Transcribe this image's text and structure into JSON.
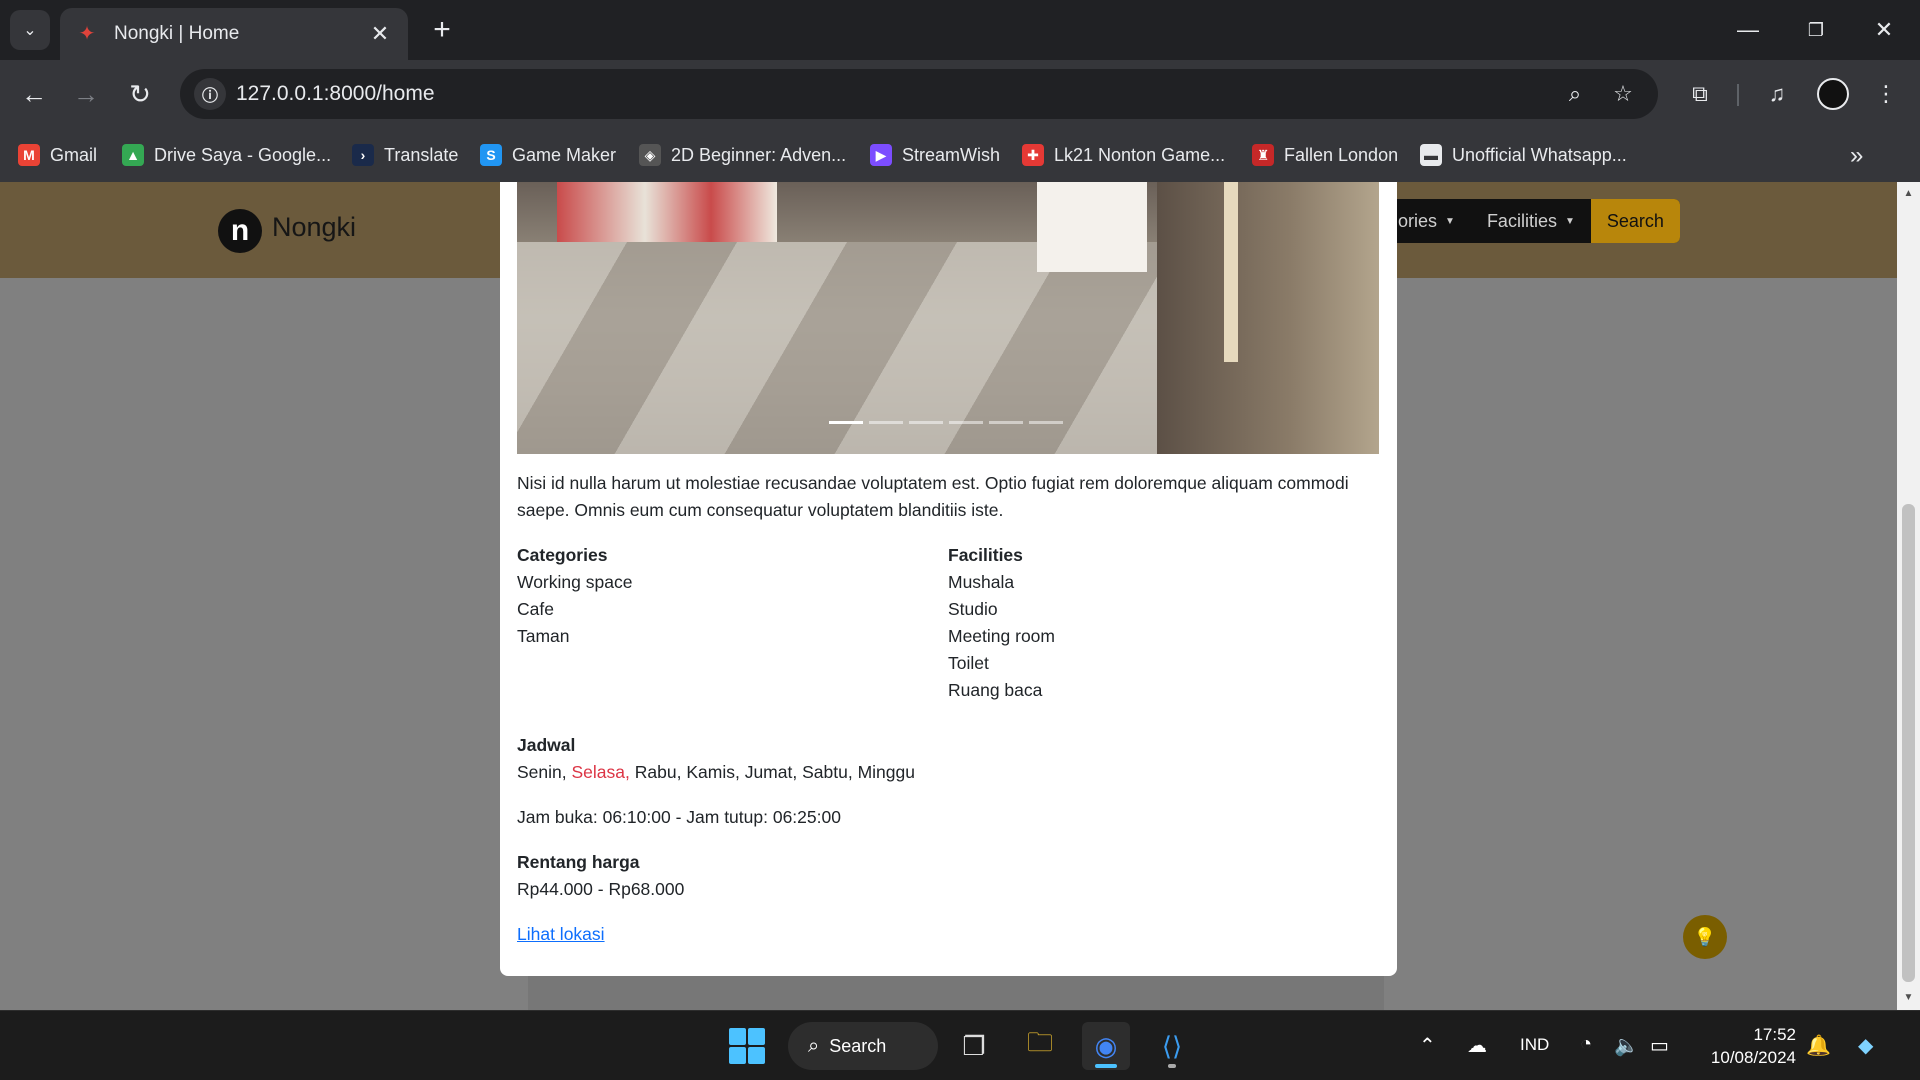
{
  "browser": {
    "tab_title": "Nongki | Home",
    "url": "127.0.0.1:8000/home",
    "bookmarks": [
      {
        "label": "Gmail",
        "icon": "gmail-icon",
        "color": "#ea4335"
      },
      {
        "label": "Drive Saya - Google...",
        "icon": "google-drive-icon",
        "color": "#34a853"
      },
      {
        "label": "Translate",
        "icon": "translate-icon",
        "color": "#1a73e8"
      },
      {
        "label": "Game Maker",
        "icon": "game-maker-icon",
        "color": "#2196f3"
      },
      {
        "label": "2D Beginner: Adven...",
        "icon": "unity-icon",
        "color": "#9e9e9e"
      },
      {
        "label": "StreamWish",
        "icon": "streamwish-icon",
        "color": "#7c4dff"
      },
      {
        "label": "Lk21 Nonton Game...",
        "icon": "lk21-icon",
        "color": "#e53935"
      },
      {
        "label": "Fallen London",
        "icon": "fallen-london-icon",
        "color": "#c62828"
      },
      {
        "label": "Unofficial Whatsapp...",
        "icon": "chat-bubble-icon",
        "color": "#e8eaed"
      }
    ]
  },
  "site": {
    "brand": "Nongki",
    "nav": {
      "categories_label": "gories",
      "facilities_label": "Facilities",
      "search_label": "Search"
    }
  },
  "carousel": {
    "slide_count": 6,
    "active_index": 0
  },
  "detail": {
    "description": "Nisi id nulla harum ut molestiae recusandae voluptatem est. Optio fugiat rem doloremque aliquam commodi saepe. Omnis eum cum consequatur voluptatem blanditiis iste.",
    "categories_title": "Categories",
    "categories": [
      "Working space",
      "Cafe",
      "Taman"
    ],
    "facilities_title": "Facilities",
    "facilities": [
      "Mushala",
      "Studio",
      "Meeting room",
      "Toilet",
      "Ruang baca"
    ],
    "schedule_title": "Jadwal",
    "days": [
      "Senin",
      "Selasa",
      "Rabu",
      "Kamis",
      "Jumat",
      "Sabtu",
      "Minggu"
    ],
    "active_day": "Selasa",
    "hours_text": "Jam buka: 06:10:00 - Jam tutup: 06:25:00",
    "price_title": "Rentang harga",
    "price_text": "Rp44.000 - Rp68.000",
    "location_link": "Lihat lokasi"
  },
  "taskbar": {
    "search_label": "Search",
    "language": "IND",
    "time": "17:52",
    "date": "10/08/2024"
  },
  "colors": {
    "accent": "#b8860b",
    "active_day": "#dc3545",
    "link": "#0d6efd"
  }
}
